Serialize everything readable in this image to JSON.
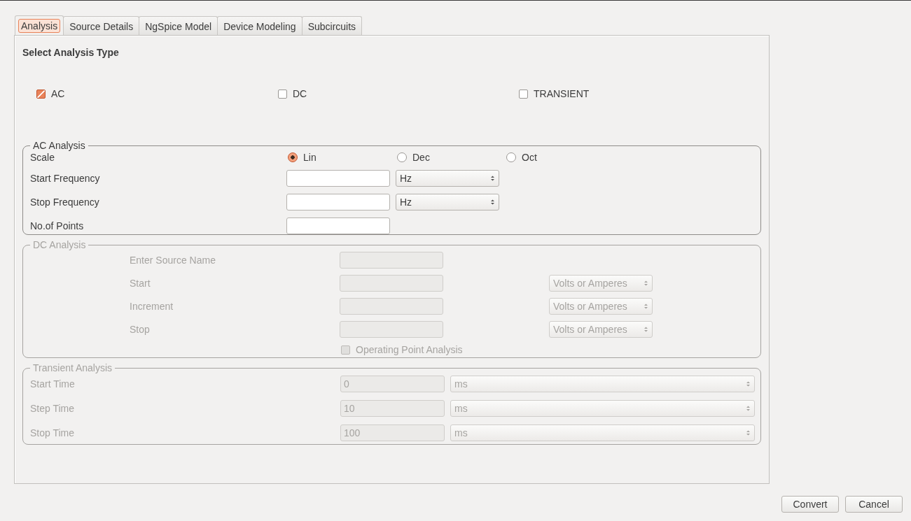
{
  "tabs": [
    {
      "label": "Analysis",
      "selected": true
    },
    {
      "label": "Source Details",
      "selected": false
    },
    {
      "label": "NgSpice Model",
      "selected": false
    },
    {
      "label": "Device Modeling",
      "selected": false
    },
    {
      "label": "Subcircuits",
      "selected": false
    }
  ],
  "analysis_type": {
    "title": "Select Analysis Type",
    "options": [
      {
        "label": "AC",
        "checked": true
      },
      {
        "label": "DC",
        "checked": false
      },
      {
        "label": "TRANSIENT",
        "checked": false
      }
    ]
  },
  "groups": [
    {
      "kind": "ac",
      "title": "AC Analysis",
      "disabled": false,
      "rows": [
        {
          "kind": "radio",
          "label": "Scale",
          "options": [
            {
              "label": "Lin",
              "selected": true
            },
            {
              "label": "Dec",
              "selected": false
            },
            {
              "label": "Oct",
              "selected": false
            }
          ]
        },
        {
          "kind": "field",
          "label": "Start Frequency",
          "unit": "Hz"
        },
        {
          "kind": "field",
          "label": "Stop Frequency",
          "unit": "Hz"
        },
        {
          "kind": "field",
          "label": "No.of Points"
        }
      ]
    },
    {
      "kind": "dc",
      "title": "DC Analysis",
      "disabled": true,
      "rows": [
        {
          "kind": "field",
          "label": "Enter Source Name"
        },
        {
          "kind": "field",
          "label": "Start",
          "unit": "Volts or Amperes"
        },
        {
          "kind": "field",
          "label": "Increment",
          "unit": "Volts or Amperes"
        },
        {
          "kind": "field",
          "label": "Stop",
          "unit": "Volts or Amperes"
        },
        {
          "kind": "checkbox",
          "label": "Operating Point Analysis",
          "checked": false
        }
      ]
    },
    {
      "kind": "transient",
      "title": "Transient Analysis",
      "disabled": true,
      "rows": [
        {
          "kind": "field",
          "label": "Start Time",
          "value": "0",
          "unit": "ms"
        },
        {
          "kind": "field",
          "label": "Step Time",
          "value": "10",
          "unit": "ms"
        },
        {
          "kind": "field",
          "label": "Stop Time",
          "value": "100",
          "unit": "ms"
        }
      ]
    }
  ],
  "buttons": [
    "Convert",
    "Cancel"
  ]
}
